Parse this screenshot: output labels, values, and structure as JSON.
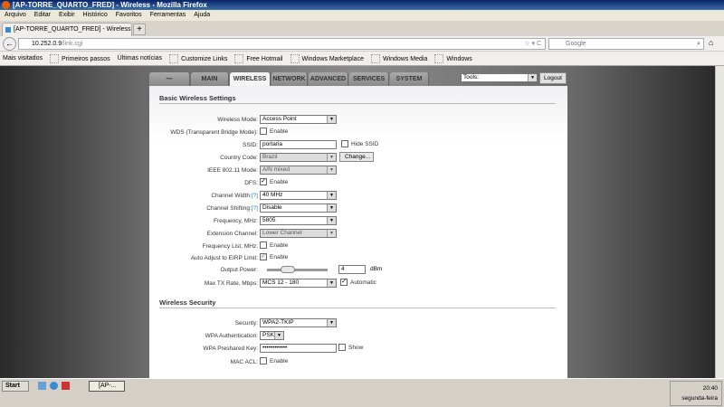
{
  "window": {
    "title": "[AP-TORRE_QUARTO_FRED] - Wireless - Mozilla Firefox"
  },
  "menu": [
    "Arquivo",
    "Editar",
    "Exibir",
    "Histórico",
    "Favoritos",
    "Ferramentas",
    "Ajuda"
  ],
  "tab": {
    "label": "[AP-TORRE_QUARTO_FRED] - Wireless",
    "new": "+"
  },
  "url": {
    "host": "10.252.0.9",
    "path": "/link.cgi"
  },
  "search": {
    "placeholder": "Google"
  },
  "bookmarks": [
    "Mais visitados",
    "Primeiros passos",
    "Últimas notícias",
    "Customize Links",
    "Free Hotmail",
    "Windows Marketplace",
    "Windows Media",
    "Windows"
  ],
  "nav": {
    "tabs": [
      "MAIN",
      "WIRELESS",
      "NETWORK",
      "ADVANCED",
      "SERVICES",
      "SYSTEM"
    ],
    "tools": "Tools:",
    "logout": "Logout"
  },
  "basic": {
    "title": "Basic Wireless Settings",
    "wireless_mode": {
      "label": "Wireless Mode:",
      "value": "Access Point"
    },
    "wds": {
      "label": "WDS (Transparent Bridge Mode):",
      "option": "Enable",
      "checked": false
    },
    "ssid": {
      "label": "SSID:",
      "value": "portaria",
      "hide": "Hide SSID"
    },
    "country": {
      "label": "Country Code:",
      "value": "Brazil",
      "change": "Change..."
    },
    "ieee": {
      "label": "IEEE 802.11 Mode:",
      "value": "A/N mixed"
    },
    "dfs": {
      "label": "DFS:",
      "option": "Enable",
      "checked": true
    },
    "channel_width": {
      "label": "Channel Width:",
      "help": "[?]",
      "value": "40 MHz"
    },
    "channel_shifting": {
      "label": "Channel Shifting:",
      "help": "[?]",
      "value": "Disable"
    },
    "frequency": {
      "label": "Frequency, MHz:",
      "value": "5805"
    },
    "extension": {
      "label": "Extension Channel:",
      "value": "Lower Channel"
    },
    "freq_list": {
      "label": "Frequency List, MHz:",
      "option": "Enable",
      "checked": false
    },
    "auto_adjust": {
      "label": "Auto Adjust to EIRP Limit:",
      "option": "Enable",
      "checked": true
    },
    "output_power": {
      "label": "Output Power:",
      "value": "4",
      "unit": "dBm",
      "slider_fraction": 0.3
    },
    "max_tx": {
      "label": "Max TX Rate, Mbps:",
      "value": "MCS 12 - 180",
      "auto": "Automatic",
      "checked": true
    }
  },
  "security": {
    "title": "Wireless Security",
    "security": {
      "label": "Security:",
      "value": "WPA2-TKIP"
    },
    "wpa_auth": {
      "label": "WPA Authentication:",
      "value": "PSK"
    },
    "psk": {
      "label": "WPA Preshared Key:",
      "value": "••••••••••••",
      "show": "Show"
    },
    "mac_acl": {
      "label": "MAC ACL:",
      "option": "Enable"
    }
  },
  "taskbar": {
    "start": "Start",
    "task": "[AP-...",
    "time": "20:40",
    "day": "segunda-feira"
  }
}
